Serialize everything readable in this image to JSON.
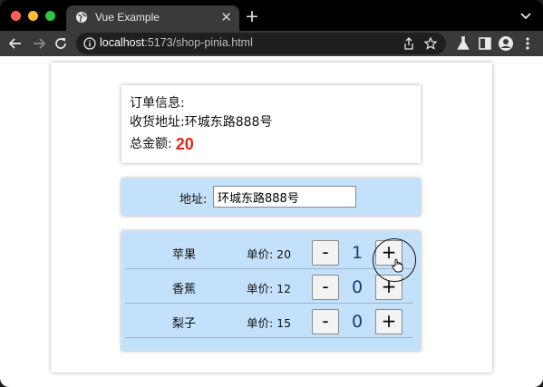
{
  "browser": {
    "tab_title": "Vue Example",
    "url_host": "localhost",
    "url_path": ":5173/shop-pinia.html"
  },
  "order": {
    "heading": "订单信息:",
    "address_label": "收货地址:",
    "address_value": "环城东路888号",
    "total_label": "总金额:",
    "total_value": "20"
  },
  "address_form": {
    "label": "地址:",
    "value": "环城东路888号"
  },
  "products": [
    {
      "name": "苹果",
      "price_label": "单价: 20",
      "qty": "1",
      "minus": "-",
      "plus": "+"
    },
    {
      "name": "香蕉",
      "price_label": "单价: 12",
      "qty": "0",
      "minus": "-",
      "plus": "+"
    },
    {
      "name": "梨子",
      "price_label": "单价: 15",
      "qty": "0",
      "minus": "-",
      "plus": "+"
    }
  ],
  "colors": {
    "accent_total": "#e8221b",
    "panel_bg": "#c3e1fb"
  }
}
